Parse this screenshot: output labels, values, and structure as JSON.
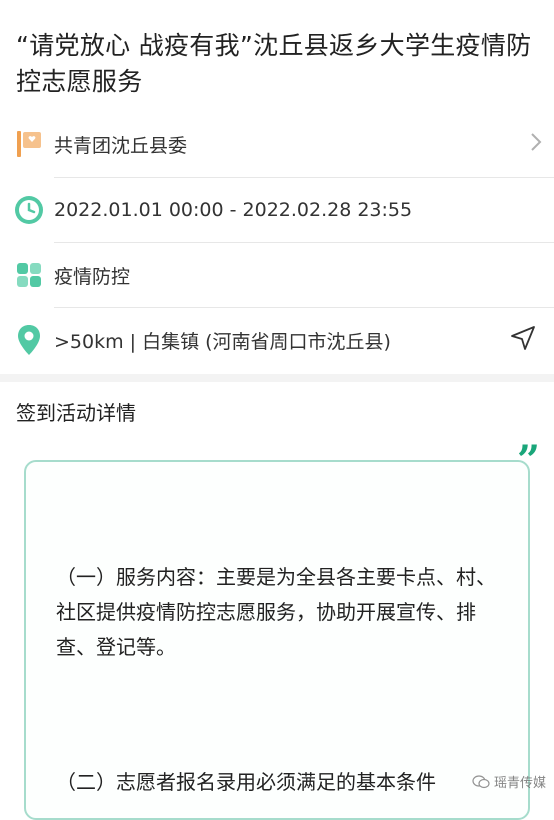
{
  "title": "“请党放心 战疫有我”沈丘县返乡大学生疫情防控志愿服务",
  "organizer": "共青团沈丘县委",
  "time_range": "2022.01.01 00:00 - 2022.02.28 23:55",
  "category": "疫情防控",
  "location": ">50km | 白集镇 (河南省周口市沈丘县)",
  "section_title": "签到活动详情",
  "details": {
    "p1": "（一）服务内容：主要是为全县各主要卡点、村、社区提供疫情防控志愿服务，协助开展宣传、排查、登记等。",
    "p2": "（二）志愿者报名录用必须满足的基本条件"
  },
  "watermark": "瑶青传媒",
  "icons": {
    "organizer": "flag-icon",
    "time": "clock-icon",
    "category": "grid-apps-icon",
    "location": "location-pin-icon",
    "navigate": "navigation-arrow-icon",
    "chevron": "chevron-right-icon",
    "quote": "quote-icon",
    "watermark": "wechat-icon"
  },
  "colors": {
    "accent_orange": "#f0a050",
    "accent_green": "#52c9a4",
    "quote_green": "#1aa67a",
    "card_border": "#a6dccc"
  }
}
